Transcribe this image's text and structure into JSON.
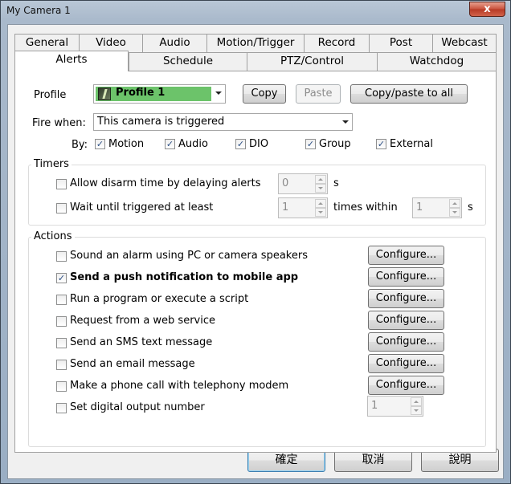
{
  "window": {
    "title": "My Camera 1",
    "close_glyph": "x"
  },
  "tabs_row1": [
    "General",
    "Video",
    "Audio",
    "Motion/Trigger",
    "Record",
    "Post",
    "Webcast"
  ],
  "tabs_row2": [
    "Alerts",
    "Schedule",
    "PTZ/Control",
    "Watchdog"
  ],
  "active_tab": "Alerts",
  "profile": {
    "label": "Profile",
    "value": "Profile 1",
    "swatch_color": "#6cc36a",
    "copy_label": "Copy",
    "paste_label": "Paste",
    "copy_all_label": "Copy/paste to all"
  },
  "fire": {
    "label": "Fire when:",
    "value": "This camera is triggered",
    "by_label": "By:",
    "options": [
      {
        "label": "Motion",
        "checked": true
      },
      {
        "label": "Audio",
        "checked": true
      },
      {
        "label": "DIO",
        "checked": true
      },
      {
        "label": "Group",
        "checked": true
      },
      {
        "label": "External",
        "checked": true
      }
    ]
  },
  "timers": {
    "title": "Timers",
    "disarm": {
      "label": "Allow disarm time by delaying alerts",
      "checked": false,
      "value": "0",
      "unit": "s"
    },
    "wait": {
      "label": "Wait until triggered at least",
      "checked": false,
      "value": "1",
      "within_label": "times within",
      "within_value": "1",
      "unit": "s"
    }
  },
  "actions": {
    "title": "Actions",
    "configure_label": "Configure...",
    "items": [
      {
        "label": "Sound an alarm using PC or camera speakers",
        "checked": false,
        "bold": false
      },
      {
        "label": "Send a push notification to mobile app",
        "checked": true,
        "bold": true
      },
      {
        "label": "Run a program or execute a script",
        "checked": false,
        "bold": false
      },
      {
        "label": "Request from a web service",
        "checked": false,
        "bold": false
      },
      {
        "label": "Send an SMS text message",
        "checked": false,
        "bold": false
      },
      {
        "label": "Send an email message",
        "checked": false,
        "bold": false
      },
      {
        "label": "Make a phone call with telephony modem",
        "checked": false,
        "bold": false
      },
      {
        "label": "Set digital output number",
        "checked": false,
        "bold": false
      }
    ],
    "output_number": "1"
  },
  "footer": {
    "ok_label": "確定",
    "cancel_label": "取消",
    "help_label": "說明"
  },
  "check_glyph": "✓"
}
